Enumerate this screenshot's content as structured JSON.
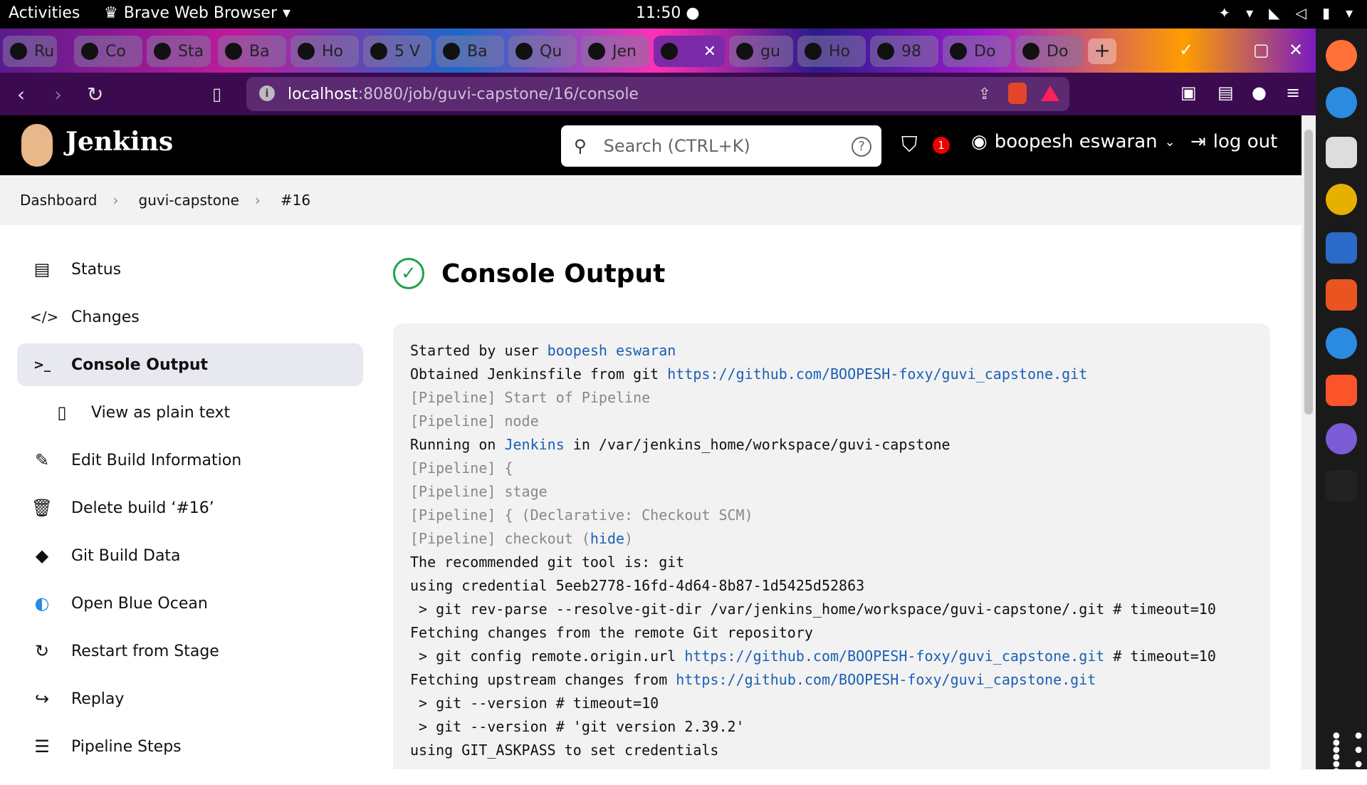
{
  "system_bar": {
    "activities": "Activities",
    "app_name": "Brave Web Browser",
    "clock": "11:50"
  },
  "tabs": [
    {
      "label": "Ru"
    },
    {
      "label": "Co"
    },
    {
      "label": "Sta"
    },
    {
      "label": "Ba"
    },
    {
      "label": "Ho"
    },
    {
      "label": "5 V"
    },
    {
      "label": "Ba"
    },
    {
      "label": "Qu"
    },
    {
      "label": "Jen"
    },
    {
      "label": "",
      "active": true
    },
    {
      "label": "gu"
    },
    {
      "label": "Ho"
    },
    {
      "label": "98"
    },
    {
      "label": "Do"
    },
    {
      "label": "Do"
    }
  ],
  "address_bar": {
    "host": "localhost",
    "path": ":8080/job/guvi-capstone/16/console"
  },
  "jenkins": {
    "title": "Jenkins",
    "search_placeholder": "Search (CTRL+K)",
    "security_count": "1",
    "user": "boopesh eswaran",
    "logout": "log out"
  },
  "breadcrumb": [
    "Dashboard",
    "guvi-capstone",
    "#16"
  ],
  "sidebar": [
    {
      "label": "Status",
      "icon": "status-icon",
      "glyph": "▤"
    },
    {
      "label": "Changes",
      "icon": "code-icon",
      "glyph": "</>"
    },
    {
      "label": "Console Output",
      "icon": "terminal-icon",
      "glyph": ">_",
      "active": true
    },
    {
      "label": "View as plain text",
      "icon": "document-icon",
      "glyph": "▯",
      "sub": true
    },
    {
      "label": "Edit Build Information",
      "icon": "edit-icon",
      "glyph": "✎"
    },
    {
      "label": "Delete build ‘#16’",
      "icon": "trash-icon",
      "glyph": "🗑"
    },
    {
      "label": "Git Build Data",
      "icon": "git-icon",
      "glyph": "◆"
    },
    {
      "label": "Open Blue Ocean",
      "icon": "blue-ocean-icon",
      "glyph": "◐"
    },
    {
      "label": "Restart from Stage",
      "icon": "restart-icon",
      "glyph": "↻"
    },
    {
      "label": "Replay",
      "icon": "replay-icon",
      "glyph": "↪"
    },
    {
      "label": "Pipeline Steps",
      "icon": "pipeline-steps-icon",
      "glyph": "☰"
    }
  ],
  "main": {
    "title": "Console Output"
  },
  "console": {
    "started_prefix": "Started by user ",
    "started_user": "boopesh eswaran",
    "obtained_prefix": "Obtained Jenkinsfile from git ",
    "repo_url": "https://github.com/BOOPESH-foxy/guvi_capstone.git",
    "pipeline_start": "[Pipeline] Start of Pipeline",
    "pipeline_node": "[Pipeline] node",
    "running_prefix": "Running on ",
    "running_node": "Jenkins",
    "running_suffix": " in /var/jenkins_home/workspace/guvi-capstone",
    "pipeline_brace": "[Pipeline] {",
    "pipeline_stage": "[Pipeline] stage",
    "pipeline_checkout_scm": "[Pipeline] { (Declarative: Checkout SCM)",
    "pipeline_checkout_prefix": "[Pipeline] checkout (",
    "hide_link": "hide",
    "pipeline_checkout_suffix": ")",
    "recommended_git": "The recommended git tool is: git",
    "using_credential": "using credential 5eeb2778-16fd-4d64-8b87-1d5425d52863",
    "rev_parse": " > git rev-parse --resolve-git-dir /var/jenkins_home/workspace/guvi-capstone/.git # timeout=10",
    "fetching_remote": "Fetching changes from the remote Git repository",
    "config_prefix": " > git config remote.origin.url ",
    "config_suffix": " # timeout=10",
    "fetching_upstream_prefix": "Fetching upstream changes from ",
    "git_version_1": " > git --version # timeout=10",
    "git_version_2": " > git --version # 'git version 2.39.2'",
    "askpass": "using GIT_ASKPASS to set credentials"
  }
}
